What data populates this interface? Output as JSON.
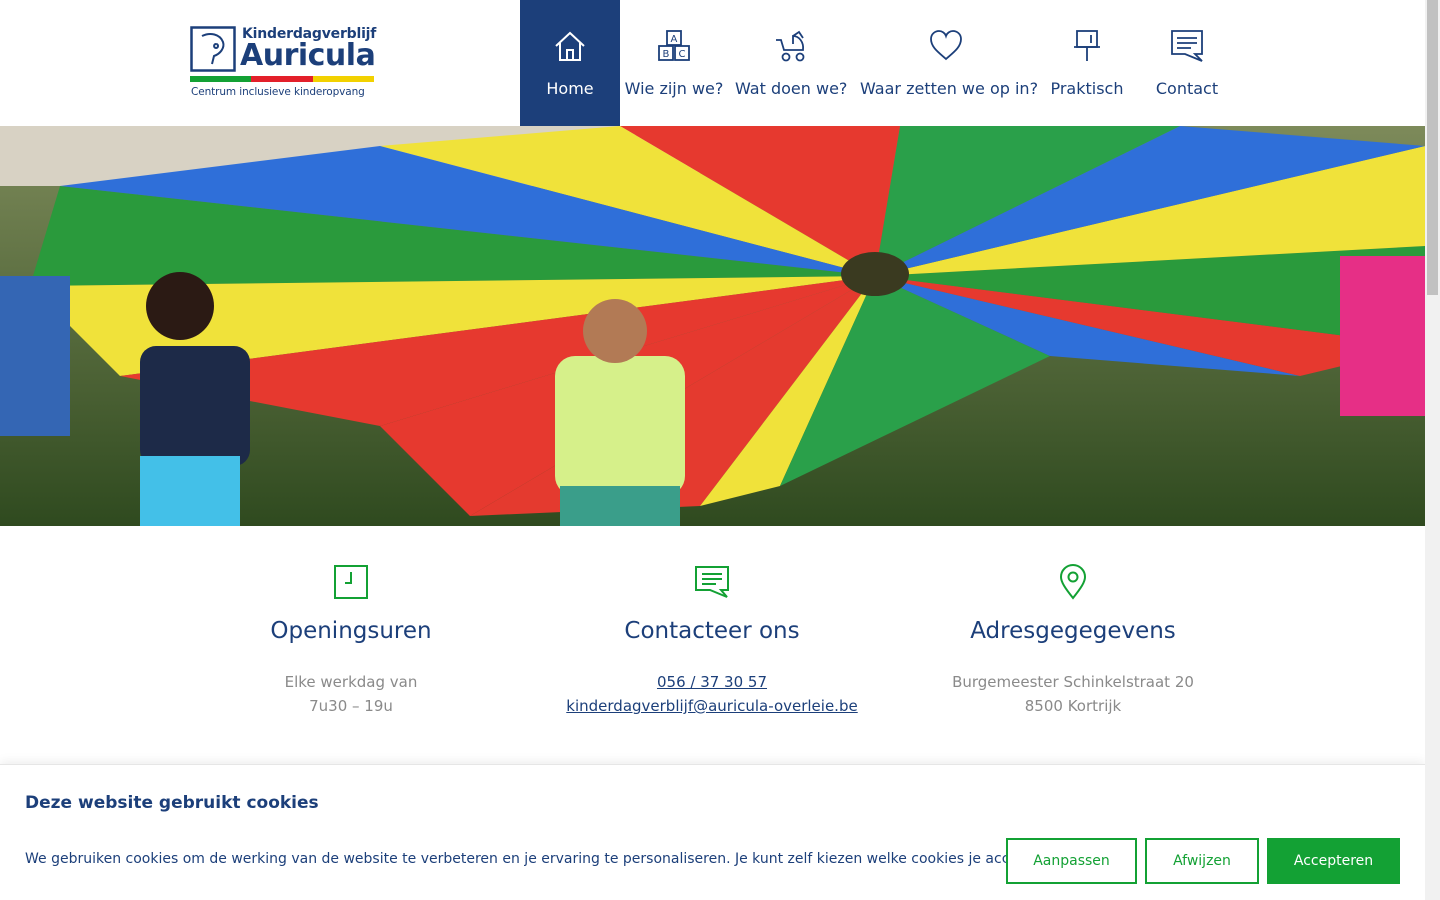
{
  "logo": {
    "line1": "Kinderdagverblijf",
    "line2": "Auricula",
    "tagline": "Centrum inclusieve kinderopvang",
    "bar_colors": [
      "#13a134",
      "#e3202a",
      "#f2d100"
    ]
  },
  "nav": {
    "items": [
      {
        "label": "Home",
        "icon": "home-icon",
        "active": true
      },
      {
        "label": "Wie zijn we?",
        "icon": "abc-blocks-icon",
        "active": false
      },
      {
        "label": "Wat doen we?",
        "icon": "stroller-icon",
        "active": false
      },
      {
        "label": "Waar zetten we op in?",
        "icon": "heart-icon",
        "active": false
      },
      {
        "label": "Praktisch",
        "icon": "pushpin-icon",
        "active": false
      },
      {
        "label": "Contact",
        "icon": "chat-icon",
        "active": false
      }
    ]
  },
  "hero": {
    "alt": "Children playing with a parachute"
  },
  "info": {
    "opening": {
      "title": "Openingsuren",
      "line1": "Elke werkdag van",
      "line2": "7u30 – 19u",
      "icon": "clock-icon"
    },
    "contact": {
      "title": "Contacteer ons",
      "phone": "056 / 37 30 57",
      "email": "kinderdagverblijf@auricula-overleie.be",
      "icon": "chat-icon"
    },
    "address": {
      "title": "Adresgegegevens",
      "line1": "Burgemeester Schinkelstraat 20",
      "line2": "8500 Kortrijk",
      "icon": "location-pin-icon"
    }
  },
  "cookie": {
    "title": "Deze website gebruikt cookies",
    "text": "We gebruiken cookies om de werking van de website te verbeteren en je ervaring te personaliseren. Je kunt zelf kiezen welke cookies je accepteert.",
    "customize_label": "Aanpassen",
    "reject_label": "Afwijzen",
    "accept_label": "Accepteren"
  },
  "colors": {
    "brand_blue": "#1c3f7a",
    "accent_green": "#13a134",
    "text_grey": "#8a8a8a"
  }
}
